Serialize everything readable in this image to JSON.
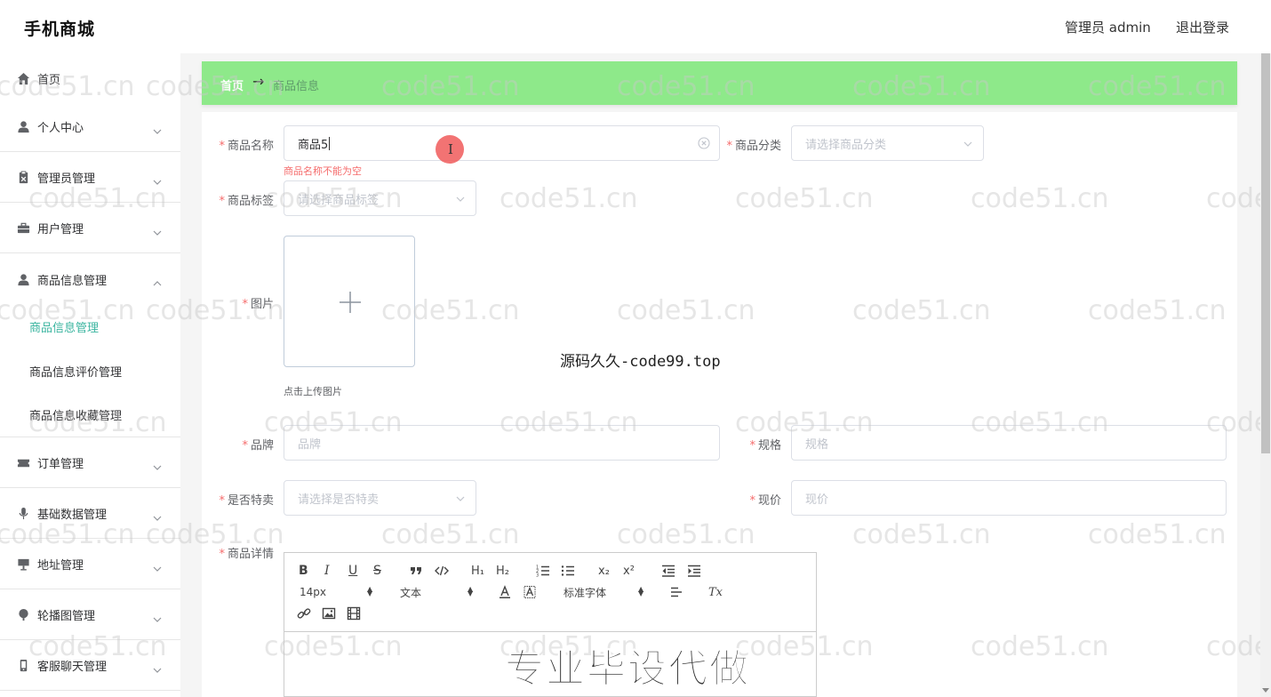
{
  "header": {
    "brand": "手机商城",
    "user_label": "管理员 admin",
    "logout_label": "退出登录"
  },
  "sidebar": {
    "items": [
      {
        "label": "首页",
        "icon": "home-icon"
      },
      {
        "label": "个人中心",
        "icon": "user-icon"
      },
      {
        "label": "管理员管理",
        "icon": "clipboard-icon"
      },
      {
        "label": "用户管理",
        "icon": "briefcase-icon"
      },
      {
        "label": "商品信息管理",
        "icon": "user-icon"
      },
      {
        "label": "订单管理",
        "icon": "ticket-icon"
      },
      {
        "label": "基础数据管理",
        "icon": "microphone-icon"
      },
      {
        "label": "地址管理",
        "icon": "monitor-icon"
      },
      {
        "label": "轮播图管理",
        "icon": "brush-icon"
      },
      {
        "label": "客服聊天管理",
        "icon": "phone-icon"
      }
    ],
    "sub_items": [
      {
        "label": "商品信息管理",
        "active": true
      },
      {
        "label": "商品信息评价管理",
        "active": false
      },
      {
        "label": "商品信息收藏管理",
        "active": false
      }
    ]
  },
  "breadcrumb": {
    "home": "首页",
    "arrow": "→",
    "current": "商品信息"
  },
  "form": {
    "name": {
      "label": "商品名称",
      "value": "商品5",
      "error": "商品名称不能为空"
    },
    "category": {
      "label": "商品分类",
      "placeholder": "请选择商品分类"
    },
    "tag": {
      "label": "商品标签",
      "placeholder": "请选择商品标签"
    },
    "image": {
      "label": "图片",
      "tip": "点击上传图片"
    },
    "brand": {
      "label": "品牌",
      "placeholder": "品牌"
    },
    "spec": {
      "label": "规格",
      "placeholder": "规格"
    },
    "special": {
      "label": "是否特卖",
      "placeholder": "请选择是否特卖"
    },
    "price": {
      "label": "现价",
      "placeholder": "现价"
    },
    "detail": {
      "label": "商品详情"
    },
    "required_mark": "*"
  },
  "editor": {
    "font_size": "14px",
    "paragraph": "文本",
    "font_family": "标准字体",
    "bold": "B",
    "italic": "I",
    "underline": "U",
    "strike": "S",
    "h1": "H₁",
    "h2": "H₂",
    "sub": "x₂",
    "sup": "x²",
    "clean": "Tx"
  },
  "watermarks": {
    "text": "code51.cn",
    "center": "源码久久-code99.top",
    "big": "专业毕设代做"
  },
  "colors": {
    "breadcrumb_bg": "#8ee98a",
    "active_menu": "#3bb5a0",
    "required": "#f56c6c",
    "cursor_highlight": "#f05a5a"
  }
}
